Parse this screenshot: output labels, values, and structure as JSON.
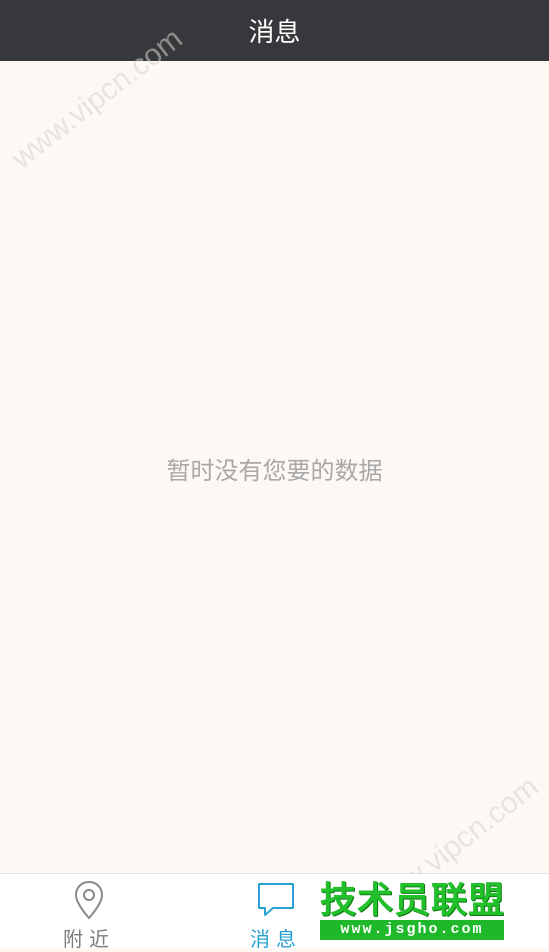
{
  "header": {
    "title": "消息"
  },
  "main": {
    "empty_message": "暂时没有您要的数据"
  },
  "watermark": {
    "text": "www.vipcn.com"
  },
  "tabbar": {
    "tabs": [
      {
        "label": "附近",
        "icon": "location-pin-icon",
        "active": false
      },
      {
        "label": "消息",
        "icon": "chat-bubble-icon",
        "active": true
      }
    ]
  },
  "logo": {
    "main": "技术员联盟",
    "sub": "www.jsgho.com"
  },
  "colors": {
    "header_bg": "#37383b",
    "content_bg": "#fdf8f4",
    "active_tab": "#2aa3d4",
    "inactive_tab": "#7d7d7d",
    "logo_green": "#22c12b"
  }
}
